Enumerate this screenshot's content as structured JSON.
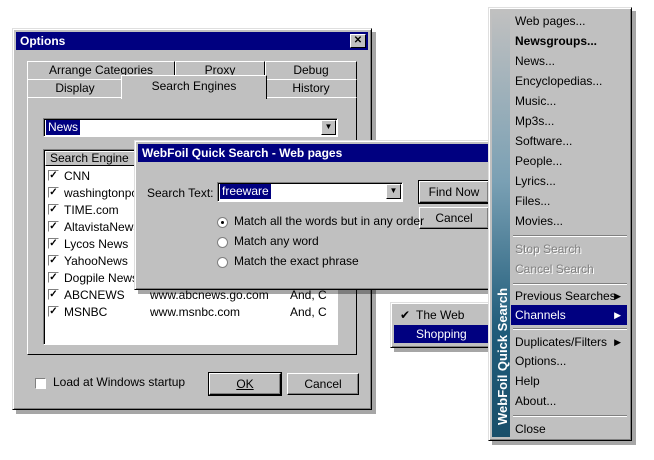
{
  "options": {
    "title": "Options",
    "tabs_back": [
      "Arrange Categories",
      "Proxy",
      "Debug"
    ],
    "tabs_front": [
      "Display",
      "Search Engines",
      "History"
    ],
    "category_value": "News",
    "list_header": "Search Engine",
    "engines": [
      {
        "name": "CNN",
        "url": "",
        "extra": ""
      },
      {
        "name": "washingtonpo...",
        "url": "",
        "extra": ""
      },
      {
        "name": "TIME.com",
        "url": "",
        "extra": ""
      },
      {
        "name": "AltavistaNews",
        "url": "",
        "extra": ""
      },
      {
        "name": "Lycos News",
        "url": "",
        "extra": ""
      },
      {
        "name": "YahooNews",
        "url": "",
        "extra": ""
      },
      {
        "name": "Dogpile News...",
        "url": "",
        "extra": ""
      },
      {
        "name": "ABCNEWS",
        "url": "www.abcnews.go.com",
        "extra": "And, C"
      },
      {
        "name": "MSNBC",
        "url": "www.msnbc.com",
        "extra": "And, C"
      }
    ],
    "startup_label": "Load at Windows startup",
    "ok_label": "OK",
    "cancel_label": "Cancel"
  },
  "quick_search": {
    "title": "WebFoil Quick Search - Web pages",
    "search_text_label": "Search Text:",
    "search_value": "freeware",
    "find_label": "Find Now",
    "cancel_label": "Cancel",
    "options": [
      "Match all the words but in any order",
      "Match any word",
      "Match the exact phrase"
    ]
  },
  "channels_submenu": {
    "items": [
      "The Web",
      "Shopping"
    ]
  },
  "main_menu": {
    "sidebar_label": "WebFoil Quick Search",
    "items": {
      "web_pages": "Web pages...",
      "newsgroups": "Newsgroups...",
      "news": "News...",
      "encyclopedias": "Encyclopedias...",
      "music": "Music...",
      "mp3s": "Mp3s...",
      "software": "Software...",
      "people": "People...",
      "lyrics": "Lyrics...",
      "files": "Files...",
      "movies": "Movies...",
      "stop_search": "Stop Search",
      "cancel_search": "Cancel Search",
      "previous_searches": "Previous Searches",
      "channels": "Channels",
      "duplicates": "Duplicates/Filters",
      "options": "Options...",
      "help": "Help",
      "about": "About...",
      "close": "Close"
    }
  },
  "colors": {
    "title_bar": "#000080",
    "face": "#c0c0c0",
    "highlight": "#000080",
    "sidebar": "#1f5c7a"
  }
}
